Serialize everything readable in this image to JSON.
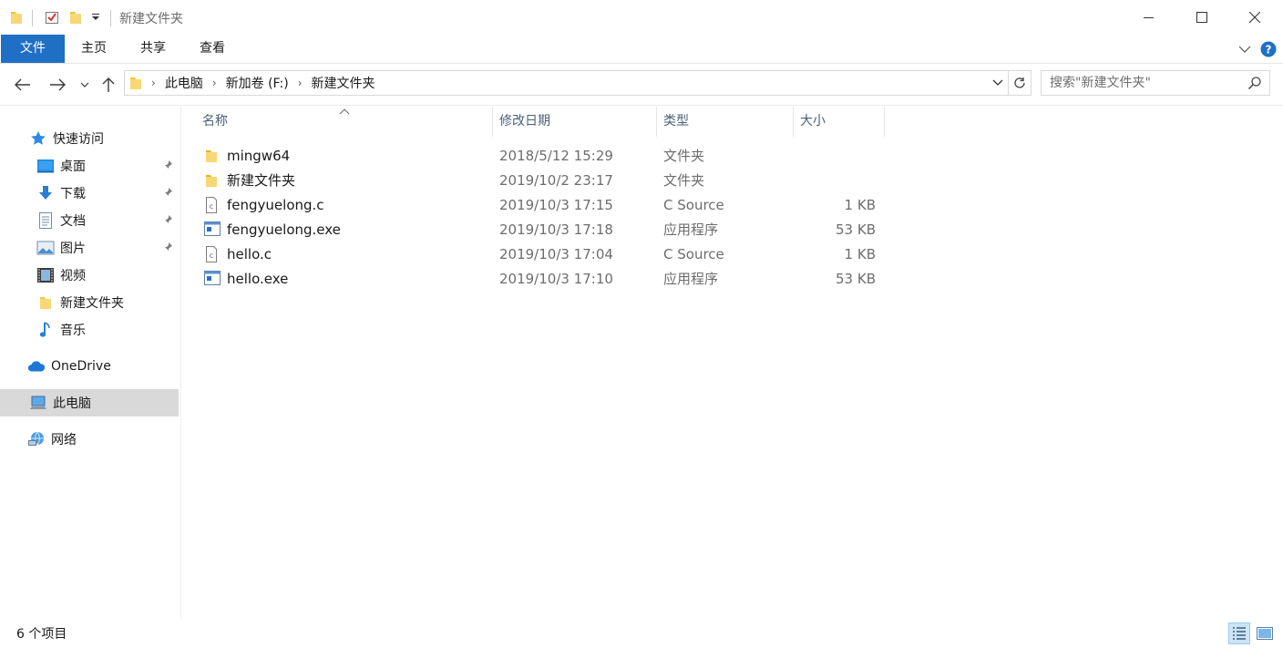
{
  "window": {
    "title": "新建文件夹"
  },
  "ribbon": {
    "tabs": [
      {
        "label": "文件"
      },
      {
        "label": "主页"
      },
      {
        "label": "共享"
      },
      {
        "label": "查看"
      }
    ]
  },
  "address": {
    "crumbs": [
      "此电脑",
      "新加卷 (F:)",
      "新建文件夹"
    ]
  },
  "search": {
    "placeholder": "搜索\"新建文件夹\""
  },
  "sidebar": {
    "quick_access": {
      "label": "快速访问"
    },
    "items": [
      {
        "label": "桌面",
        "icon": "desktop-icon",
        "pinned": true
      },
      {
        "label": "下载",
        "icon": "download-icon",
        "pinned": true
      },
      {
        "label": "文档",
        "icon": "document-icon",
        "pinned": true
      },
      {
        "label": "图片",
        "icon": "picture-icon",
        "pinned": true
      },
      {
        "label": "视频",
        "icon": "video-icon",
        "pinned": false
      },
      {
        "label": "新建文件夹",
        "icon": "folder-icon",
        "pinned": false
      },
      {
        "label": "音乐",
        "icon": "music-icon",
        "pinned": false
      }
    ],
    "onedrive": {
      "label": "OneDrive"
    },
    "this_pc": {
      "label": "此电脑",
      "selected": true
    },
    "network": {
      "label": "网络"
    }
  },
  "columns": {
    "name": "名称",
    "date": "修改日期",
    "type": "类型",
    "size": "大小"
  },
  "files": [
    {
      "name": "mingw64",
      "date": "2018/5/12 15:29",
      "type": "文件夹",
      "size": "",
      "icon": "folder-icon"
    },
    {
      "name": "新建文件夹",
      "date": "2019/10/2 23:17",
      "type": "文件夹",
      "size": "",
      "icon": "folder-icon"
    },
    {
      "name": "fengyuelong.c",
      "date": "2019/10/3 17:15",
      "type": "C Source",
      "size": "1 KB",
      "icon": "c-source-file-icon"
    },
    {
      "name": "fengyuelong.exe",
      "date": "2019/10/3 17:18",
      "type": "应用程序",
      "size": "53 KB",
      "icon": "application-icon"
    },
    {
      "name": "hello.c",
      "date": "2019/10/3 17:04",
      "type": "C Source",
      "size": "1 KB",
      "icon": "c-source-file-icon"
    },
    {
      "name": "hello.exe",
      "date": "2019/10/3 17:10",
      "type": "应用程序",
      "size": "53 KB",
      "icon": "application-icon"
    }
  ],
  "status": {
    "item_count": "6 个项目"
  },
  "colors": {
    "accent": "#1f6fc5",
    "folder": "#f5c542",
    "selected_bg": "#d9d9d9"
  }
}
